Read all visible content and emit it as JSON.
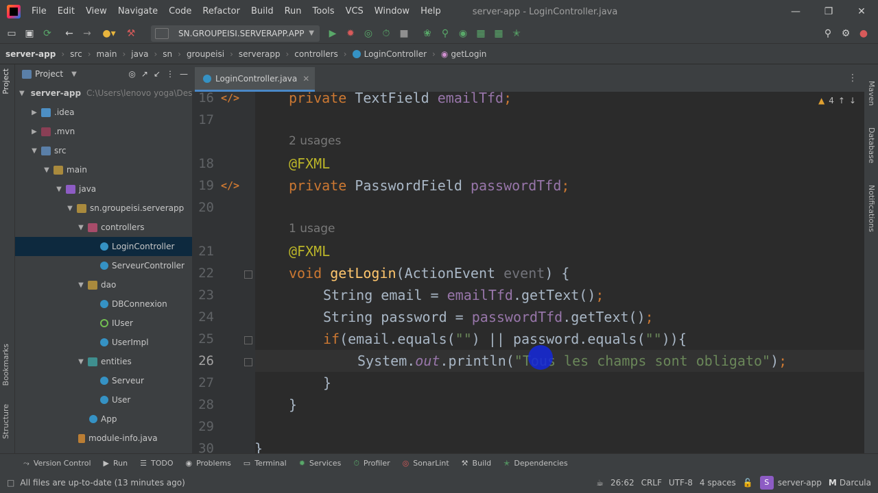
{
  "menu": [
    "File",
    "Edit",
    "View",
    "Navigate",
    "Code",
    "Refactor",
    "Build",
    "Run",
    "Tools",
    "VCS",
    "Window",
    "Help"
  ],
  "window_title": "server-app - LoginController.java",
  "toolbar": {
    "run_config": "SN.GROUPEISI.SERVERAPP.APP"
  },
  "breadcrumb": [
    "server-app",
    "src",
    "main",
    "java",
    "sn",
    "groupeisi",
    "serverapp",
    "controllers",
    "LoginController",
    "getLogin"
  ],
  "left_tabs": {
    "project": "Project",
    "bookmarks": "Bookmarks",
    "structure": "Structure"
  },
  "project_panel": {
    "title": "Project",
    "tree": [
      {
        "label": "server-app",
        "path": "C:\\Users\\lenovo yoga\\Deskto"
      },
      {
        "label": ".idea"
      },
      {
        "label": ".mvn"
      },
      {
        "label": "src"
      },
      {
        "label": "main"
      },
      {
        "label": "java"
      },
      {
        "label": "sn.groupeisi.serverapp"
      },
      {
        "label": "controllers"
      },
      {
        "label": "LoginController"
      },
      {
        "label": "ServeurController"
      },
      {
        "label": "dao"
      },
      {
        "label": "DBConnexion"
      },
      {
        "label": "IUser"
      },
      {
        "label": "UserImpl"
      },
      {
        "label": "entities"
      },
      {
        "label": "Serveur"
      },
      {
        "label": "User"
      },
      {
        "label": "App"
      },
      {
        "label": "module-info.java"
      }
    ]
  },
  "editor": {
    "tab": "LoginController.java",
    "warning_count": "4",
    "line_numbers": [
      "16",
      "17",
      "18",
      "19",
      "20",
      "21",
      "22",
      "23",
      "24",
      "25",
      "26",
      "27",
      "28",
      "29",
      "30"
    ],
    "usage_hints": [
      "2 usages",
      "1 usage"
    ],
    "code": {
      "l16": {
        "kw": "private",
        "type": "TextField",
        "field": "emailTfd",
        "end": ";"
      },
      "l18": "@FXML",
      "l19": {
        "kw": "private",
        "type": "PasswordField",
        "field": "passwordTfd",
        "end": ";"
      },
      "l21": "@FXML",
      "l22": {
        "kw": "void",
        "fn": "getLogin",
        "open": "(ActionEvent",
        "param": "event",
        "close": ") {"
      },
      "l23": {
        "a": "String email = ",
        "fld": "emailTfd",
        "b": ".getText()",
        "end": ";"
      },
      "l24": {
        "a": "String password = ",
        "fld": "passwordTfd",
        "b": ".getText()",
        "end": ";"
      },
      "l25": {
        "kw": "if",
        "a": "(email.equals(",
        "s1": "\"\"",
        "b": ") || password.equals(",
        "s2": "\"\"",
        "c": ")){"
      },
      "l26": {
        "a": "System.",
        "out": "out",
        "b": ".println(",
        "str": "\"Tous les champs sont obligato\"",
        "c": ")",
        "end": ";"
      },
      "l27": "}",
      "l28": "}",
      "l30": "}"
    }
  },
  "right_tabs": {
    "maven": "Maven",
    "database": "Database",
    "notifications": "Notifications"
  },
  "bottom_tools": [
    "Version Control",
    "Run",
    "TODO",
    "Problems",
    "Terminal",
    "Services",
    "Profiler",
    "SonarLint",
    "Build",
    "Dependencies"
  ],
  "status": {
    "message": "All files are up-to-date (13 minutes ago)",
    "position": "26:62",
    "line_sep": "CRLF",
    "encoding": "UTF-8",
    "indent": "4 spaces",
    "project": "server-app",
    "theme": "Darcula"
  },
  "colors": {
    "keyword": "#cc7832",
    "field": "#9876aa",
    "annotation": "#bbb529",
    "function": "#ffc66d",
    "string": "#6a8759",
    "selection": "#0d293e"
  }
}
